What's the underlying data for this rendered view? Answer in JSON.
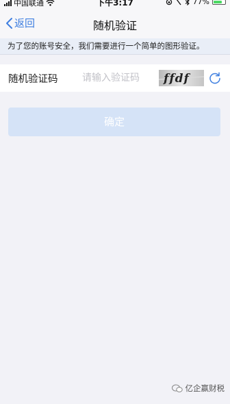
{
  "status_bar": {
    "carrier": "中国联通",
    "time": "下午3:17",
    "battery_percent": "77%",
    "battery_level": 0.77
  },
  "nav": {
    "back_label": "返回",
    "title": "随机验证"
  },
  "notice": "为了您的账号安全，我们需要进行一个简单的图形验证。",
  "captcha": {
    "label": "随机验证码",
    "placeholder": "请输入验证码",
    "image_text": "ffdf"
  },
  "confirm_label": "确定",
  "watermark": "亿企赢财税",
  "colors": {
    "accent": "#3f7fe0",
    "button_disabled": "#d5e3f7",
    "notice_bg": "#e9eef7"
  }
}
